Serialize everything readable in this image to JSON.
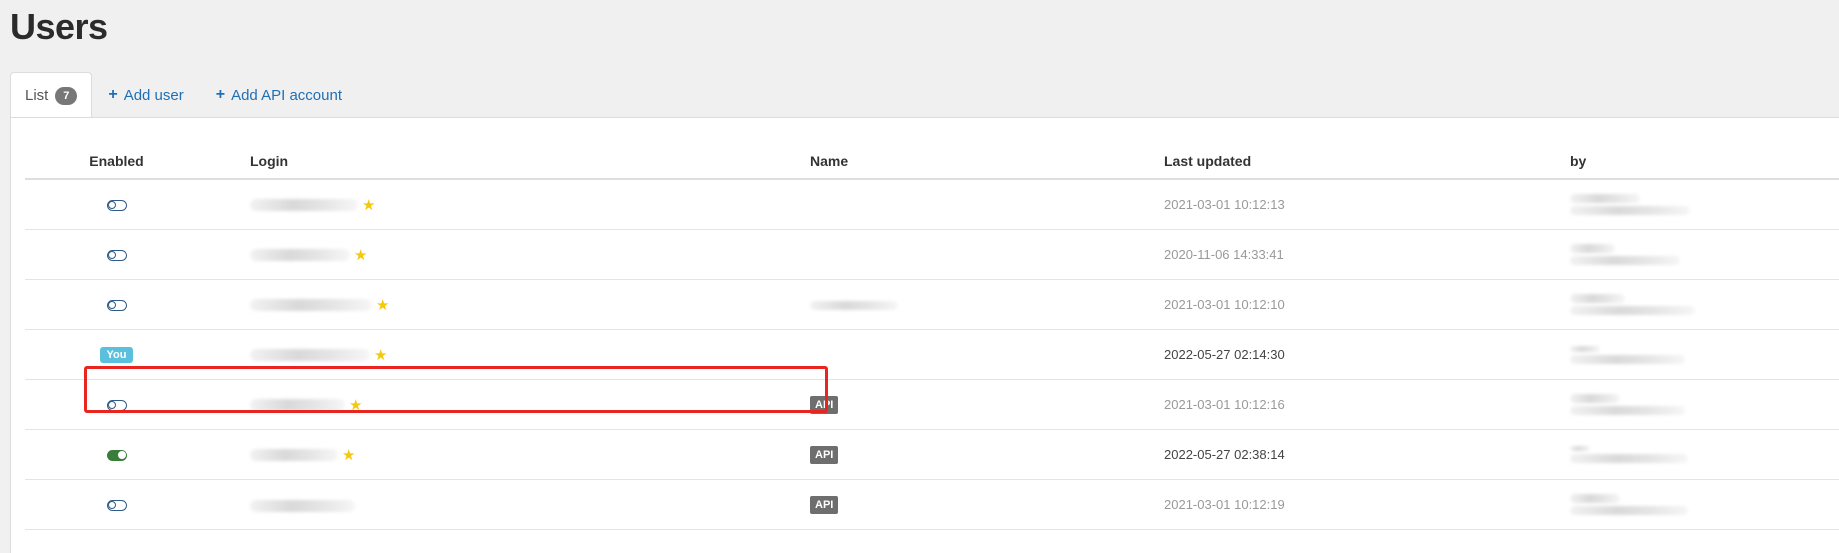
{
  "page": {
    "title": "Users"
  },
  "tabs": [
    {
      "label": "List",
      "count": "7"
    },
    {
      "label": "Add user"
    },
    {
      "label": "Add API account"
    }
  ],
  "table": {
    "headers": {
      "enabled": "Enabled",
      "login": "Login",
      "name": "Name",
      "last_updated": "Last updated",
      "by": "by"
    },
    "rows": [
      {
        "enabled": "off",
        "last_updated": "2021-03-01 10:12:13"
      },
      {
        "enabled": "off",
        "last_updated": "2020-11-06 14:33:41"
      },
      {
        "enabled": "off",
        "last_updated": "2021-03-01 10:12:10"
      },
      {
        "enabled": "you",
        "you_label": "You",
        "last_updated": "2022-05-27 02:14:30"
      },
      {
        "enabled": "off",
        "name_badge": "API",
        "last_updated": "2021-03-01 10:12:16"
      },
      {
        "enabled": "on",
        "name_badge": "API",
        "last_updated": "2022-05-27 02:38:14"
      },
      {
        "enabled": "off",
        "name_badge": "API",
        "last_updated": "2021-03-01 10:12:19"
      }
    ]
  },
  "icons": {
    "plus": "plus-icon",
    "star": "star-icon",
    "toggle": "toggle-switch-icon"
  },
  "colors": {
    "link": "#1f6fb5",
    "star": "#f3c90d",
    "toggle_on": "#3a7d3a",
    "you_badge": "#5bc0de",
    "api_badge": "#6e6e6e",
    "highlight": "#e8251f"
  }
}
